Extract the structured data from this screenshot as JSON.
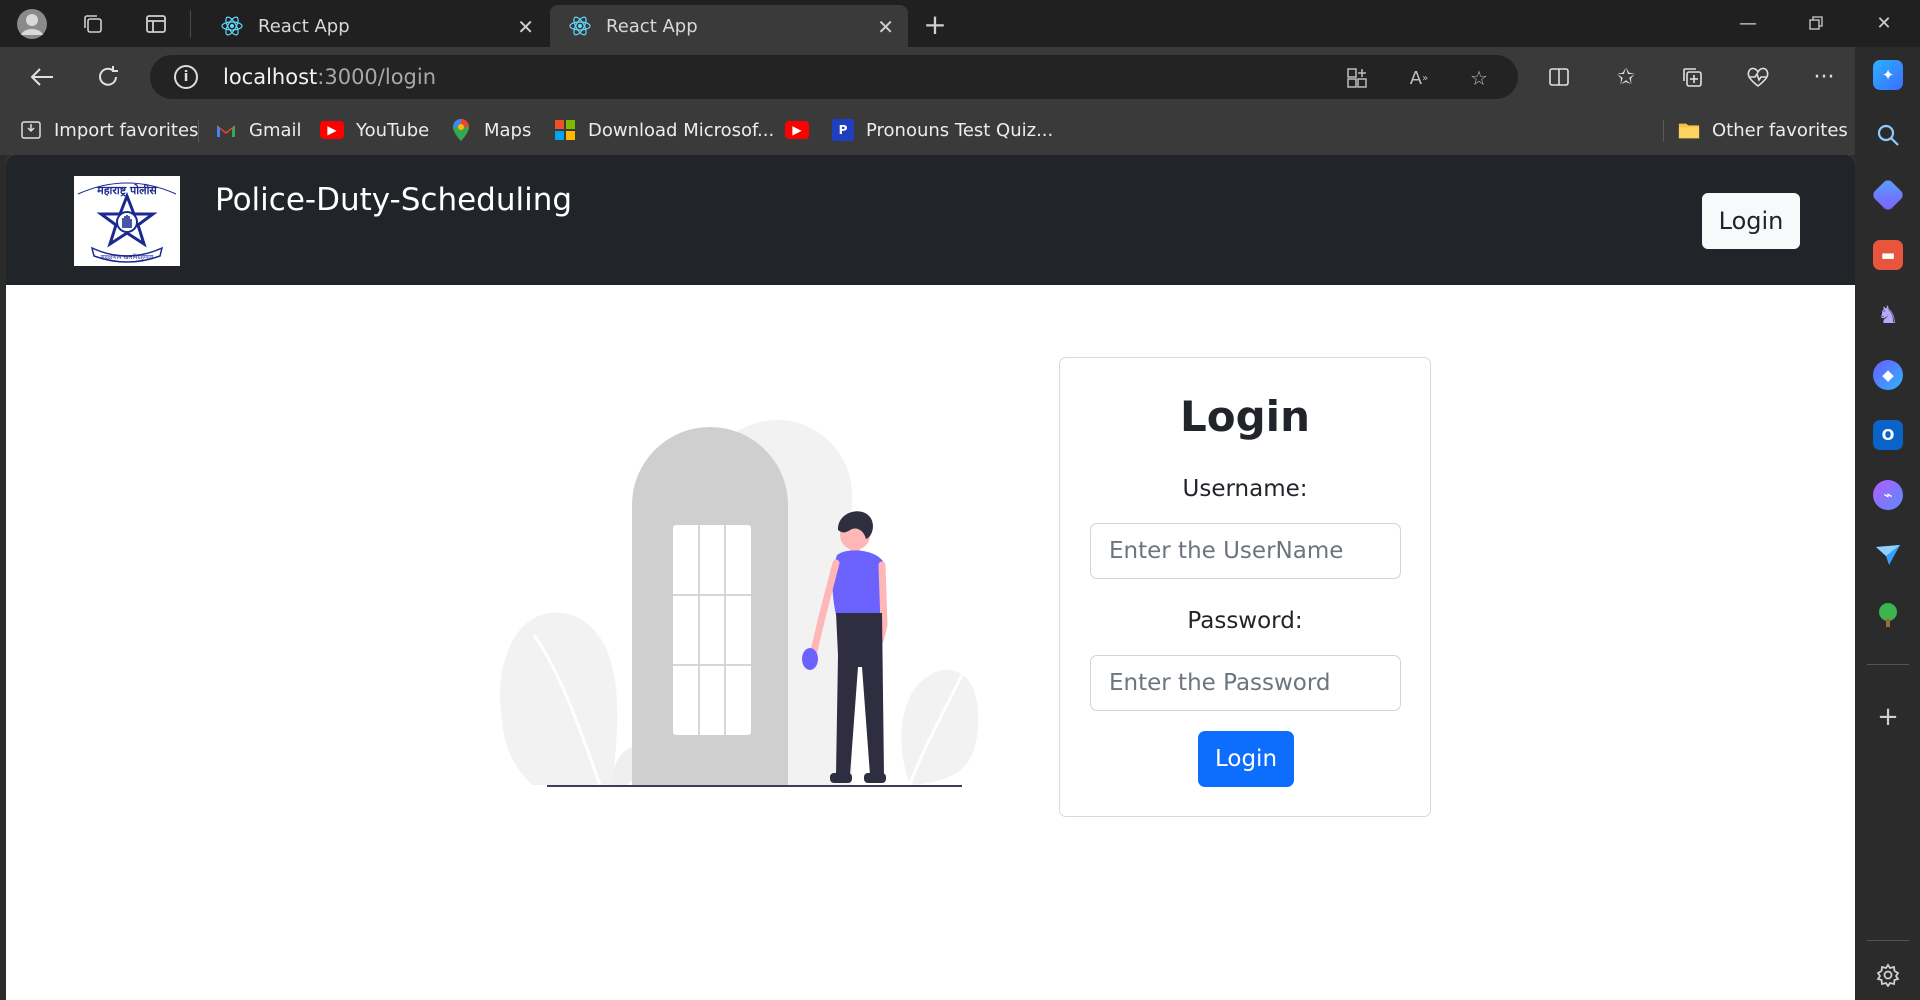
{
  "browser": {
    "tabs": [
      {
        "title": "React App",
        "active": false
      },
      {
        "title": "React App",
        "active": true
      }
    ],
    "address": {
      "host": "localhost",
      "path": ":3000/login"
    },
    "favorites": [
      {
        "label": "Import favorites",
        "icon": "import-favorites-icon"
      },
      {
        "label": "Gmail",
        "icon": "gmail-icon"
      },
      {
        "label": "YouTube",
        "icon": "youtube-icon"
      },
      {
        "label": "Maps",
        "icon": "maps-icon"
      },
      {
        "label": "Download Microsof...",
        "icon": "microsoft-icon"
      },
      {
        "label": "",
        "icon": "youtube-icon"
      },
      {
        "label": "Pronouns Test Quiz...",
        "icon": "pronouns-icon"
      }
    ],
    "other_favorites": "Other favorites"
  },
  "navbar": {
    "brand": "Police-Duty-Scheduling",
    "login_label": "Login",
    "logo_text_top": "महाराष्ट्र पोलीस",
    "logo_text_bottom": "सद्रक्षणाय खलनिग्रहणाय"
  },
  "login_form": {
    "title": "Login",
    "username_label": "Username:",
    "username_placeholder": "Enter the UserName",
    "password_label": "Password:",
    "password_placeholder": "Enter the Password",
    "submit_label": "Login"
  },
  "colors": {
    "navbar_bg": "#212529",
    "primary_button": "#0d6efd",
    "illustration_accent": "#6c63ff"
  }
}
